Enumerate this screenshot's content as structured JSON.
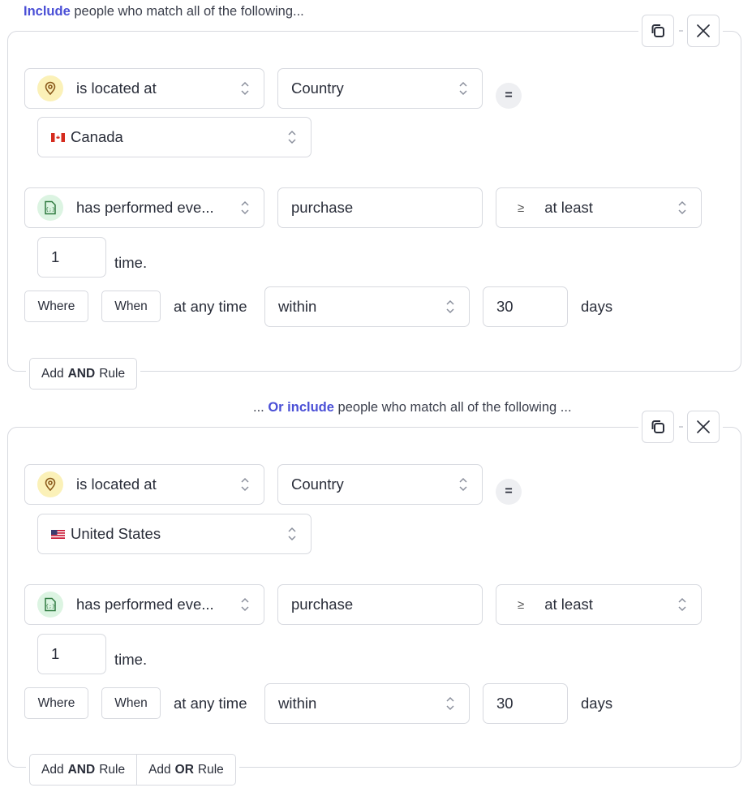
{
  "groups": [
    {
      "heading_prefix": "",
      "heading_accent": "Include",
      "heading_text": " people who match all of the following...",
      "actions": {
        "duplicate_icon": "copy-icon",
        "remove_icon": "close-icon"
      },
      "location_rule": {
        "type_icon": "map-pin-icon",
        "type_label": "is located at",
        "field": "Country",
        "operator": "=",
        "value_flag": "CA",
        "value": "Canada"
      },
      "event_rule": {
        "type_icon": "event-file-icon",
        "type_label": "has performed eve...",
        "event_name": "purchase",
        "comparator_symbol": "≥",
        "comparator": "at least",
        "count": "1",
        "count_suffix": "time.",
        "where_label": "Where",
        "when_label": "When",
        "time_prefix": "at any time",
        "time_operator": "within",
        "time_value": "30",
        "time_unit": "days"
      },
      "add_buttons": [
        {
          "pre": "Add",
          "bold": "AND",
          "post": "Rule"
        }
      ]
    },
    {
      "heading_prefix": "... ",
      "heading_accent": "Or include",
      "heading_text": " people who match all of the following ...",
      "actions": {
        "duplicate_icon": "copy-icon",
        "remove_icon": "close-icon"
      },
      "location_rule": {
        "type_icon": "map-pin-icon",
        "type_label": "is located at",
        "field": "Country",
        "operator": "=",
        "value_flag": "US",
        "value": "United States"
      },
      "event_rule": {
        "type_icon": "event-file-icon",
        "type_label": "has performed eve...",
        "event_name": "purchase",
        "comparator_symbol": "≥",
        "comparator": "at least",
        "count": "1",
        "count_suffix": "time.",
        "where_label": "Where",
        "when_label": "When",
        "time_prefix": "at any time",
        "time_operator": "within",
        "time_value": "30",
        "time_unit": "days"
      },
      "add_buttons": [
        {
          "pre": "Add",
          "bold": "AND",
          "post": "Rule"
        },
        {
          "pre": "Add",
          "bold": "OR",
          "post": "Rule"
        }
      ]
    }
  ],
  "colors": {
    "accent": "#4a4fd6",
    "border": "#d7d9df",
    "location_badge": "#fbf1b8",
    "event_badge": "#dcf4e2",
    "text": "#2a2e3a"
  }
}
